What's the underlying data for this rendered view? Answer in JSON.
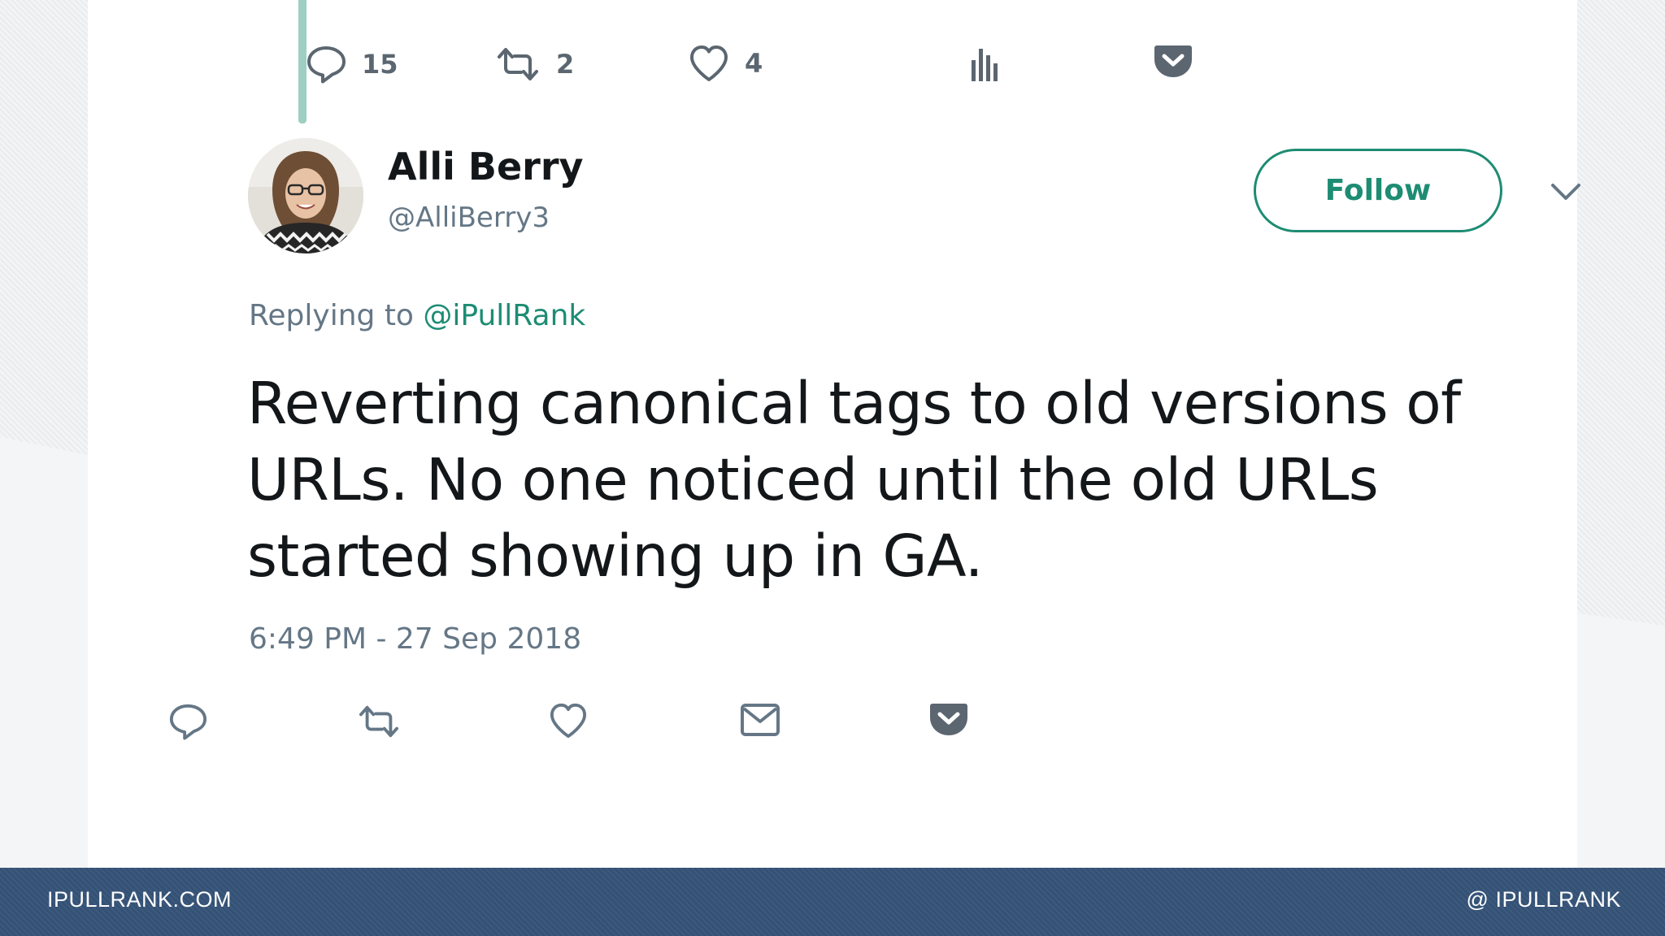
{
  "previous_tweet_actions": {
    "reply_count": "15",
    "retweet_count": "2",
    "like_count": "4"
  },
  "tweet": {
    "author_name": "Alli Berry",
    "author_handle": "@AlliBerry3",
    "follow_label": "Follow",
    "replying_prefix": "Replying to ",
    "replying_handle": "@iPullRank",
    "text": "Reverting canonical tags to old versions of URLs. No one noticed until the old URLs started showing up in GA.",
    "timestamp": "6:49 PM - 27 Sep 2018"
  },
  "footer": {
    "left": "IPULLRANK.COM",
    "right": "@ IPULLRANK"
  },
  "colors": {
    "accent": "#1d8c73",
    "thread_line": "#9fcfc2",
    "footer_bg": "#3c5a80",
    "icon_gray": "#657786"
  }
}
